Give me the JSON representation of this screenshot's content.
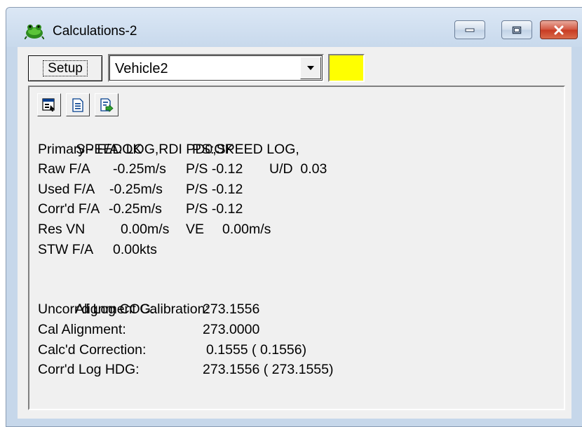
{
  "window": {
    "title": "Calculations-2",
    "app_icon": "green-frog-icon",
    "controls": [
      "minimize-icon",
      "maximize-icon",
      "close-icon"
    ]
  },
  "toolbar": {
    "setup_label": "Setup",
    "vehicle_select": {
      "value": "Vehicle2"
    },
    "status_color": "#ffff00"
  },
  "panel_tools": [
    "window-icon",
    "document-icon",
    "export-icon"
  ],
  "readout": {
    "header": "SPEED LOG,RDI PD0,SPEED LOG,",
    "primary": {
      "label": "Primary - F/A:OK",
      "ps": "PS:OK"
    },
    "raw": {
      "label": "Raw F/A",
      "fa": "-0.25m/s",
      "ps": "P/S -0.12",
      "ud": "U/D  0.03"
    },
    "used": {
      "label": "Used F/A",
      "fa": "-0.25m/s",
      "ps": "P/S -0.12"
    },
    "corrd": {
      "label": "Corr'd F/A",
      "fa": "-0.25m/s",
      "ps": "P/S -0.12"
    },
    "res": {
      "label": "Res VN",
      "vn": "0.00m/s",
      "ve_label": "VE",
      "ve": "0.00m/s"
    },
    "stw": {
      "label": "STW F/A",
      "value": "0.00kts"
    }
  },
  "alignment": {
    "heading": "Alignment Calibration:",
    "uncorrd_label": "Uncorr'd Log COG:",
    "uncorrd_value": "273.1556",
    "cal_label": "Cal Alignment:",
    "cal_value": "273.0000",
    "calcd_label": "Calc'd Correction:",
    "calcd_value": "0.1555 ( 0.1556)",
    "hdg_label": "Corr'd Log HDG:",
    "hdg_value": "273.1556 ( 273.1555)"
  }
}
